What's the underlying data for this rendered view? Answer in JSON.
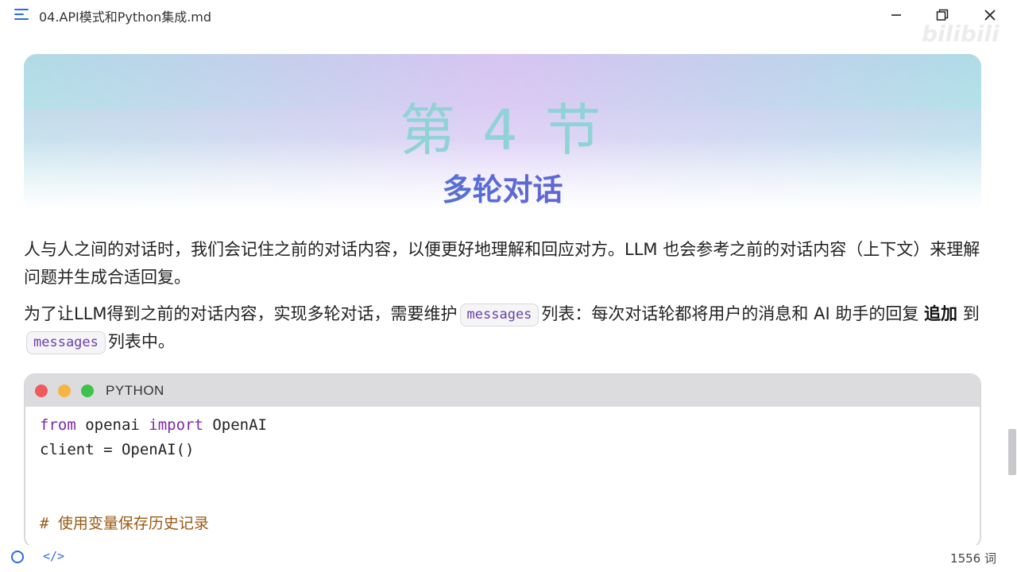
{
  "window": {
    "title": "04.API模式和Python集成.md"
  },
  "watermark": "bilibili",
  "hero": {
    "title": "第 4 节",
    "subtitle": "多轮对话"
  },
  "content": {
    "p1": "人与人之间的对话时，我们会记住之前的对话内容，以便更好地理解和回应对方。LLM 也会参考之前的对话内容（上下文）来理解问题并生成合适回复。",
    "p2_a": "为了让LLM得到之前的对话内容，实现多轮对话，需要维护",
    "p2_code1": "messages",
    "p2_b": "列表：每次对话轮都将用户的消息和 AI 助手的回复",
    "p2_bold": "追加",
    "p2_c": "到",
    "p2_code2": "messages",
    "p2_d": "列表中。"
  },
  "code": {
    "language": "PYTHON",
    "line1_kw1": "from",
    "line1_mod": " openai ",
    "line1_kw2": "import",
    "line1_name": " OpenAI",
    "line2": "client = OpenAI()",
    "line3_comment": "# 使用变量保存历史记录"
  },
  "status": {
    "code_toggle": "</>",
    "word_count": "1556 词"
  },
  "colors": {
    "accent": "#2d6cdf",
    "hero_title": "#8fd3d6",
    "keyword": "#7b2aa6",
    "comment": "#9a5a14"
  }
}
